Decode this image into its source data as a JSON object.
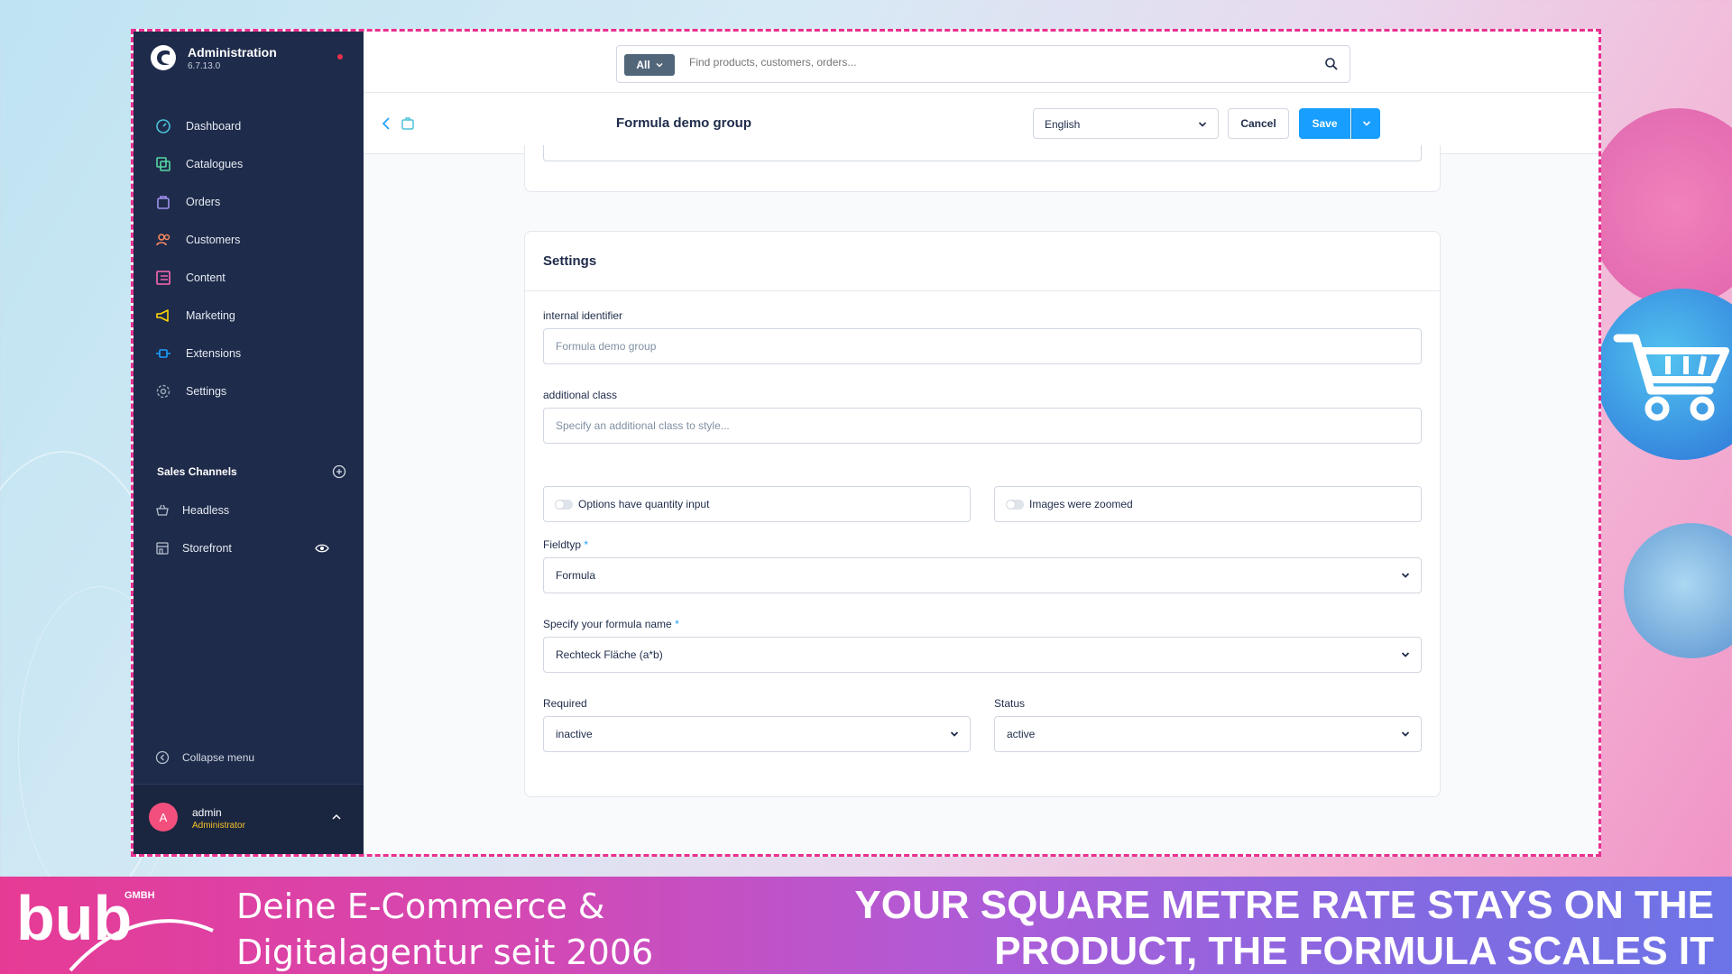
{
  "app": {
    "title": "Administration",
    "version": "6.7.13.0"
  },
  "sidebar": {
    "items": [
      {
        "label": "Dashboard",
        "icon": "dashboard-icon"
      },
      {
        "label": "Catalogues",
        "icon": "catalogues-icon"
      },
      {
        "label": "Orders",
        "icon": "orders-icon"
      },
      {
        "label": "Customers",
        "icon": "customers-icon"
      },
      {
        "label": "Content",
        "icon": "content-icon"
      },
      {
        "label": "Marketing",
        "icon": "marketing-icon"
      },
      {
        "label": "Extensions",
        "icon": "extensions-icon"
      },
      {
        "label": "Settings",
        "icon": "settings-icon"
      }
    ],
    "sales_channels_title": "Sales Channels",
    "sales_channels": [
      {
        "label": "Headless",
        "icon": "basket-icon"
      },
      {
        "label": "Storefront",
        "icon": "storefront-icon"
      }
    ],
    "collapse_label": "Collapse menu",
    "user": {
      "initial": "A",
      "name": "admin",
      "role": "Administrator"
    }
  },
  "search": {
    "type_label": "All",
    "placeholder": "Find products, customers, orders..."
  },
  "smartbar": {
    "title": "Formula demo group",
    "language": "English",
    "cancel_label": "Cancel",
    "save_label": "Save"
  },
  "settings": {
    "title": "Settings",
    "internal_identifier": {
      "label": "internal identifier",
      "placeholder": "Formula demo group"
    },
    "additional_class": {
      "label": "additional class",
      "placeholder": "Specify an additional class to style..."
    },
    "switch_quantity": {
      "label": "Options have quantity input",
      "on": false
    },
    "switch_zoom": {
      "label": "Images were zoomed",
      "on": false
    },
    "fieldtyp": {
      "label": "Fieldtyp",
      "required_mark": "*",
      "value": "Formula"
    },
    "formula_name": {
      "label": "Specify your formula name",
      "required_mark": "*",
      "value": "Rechteck Fläche (a*b)"
    },
    "required": {
      "label": "Required",
      "value": "inactive"
    },
    "status": {
      "label": "Status",
      "value": "active"
    }
  },
  "banner": {
    "logo_text": "bub",
    "logo_sub": "GMBH",
    "tagline_line1": "Deine E-Commerce &",
    "tagline_line2": "Digitalagentur seit 2006",
    "headline_line1": "YOUR SQUARE METRE RATE STAYS ON THE",
    "headline_line2": "PRODUCT, THE FORMULA SCALES IT"
  },
  "colors": {
    "sidebar_bg": "#1e2b4a",
    "accent": "#189eff",
    "frame_border": "#e8308f",
    "role": "#f6c324"
  }
}
